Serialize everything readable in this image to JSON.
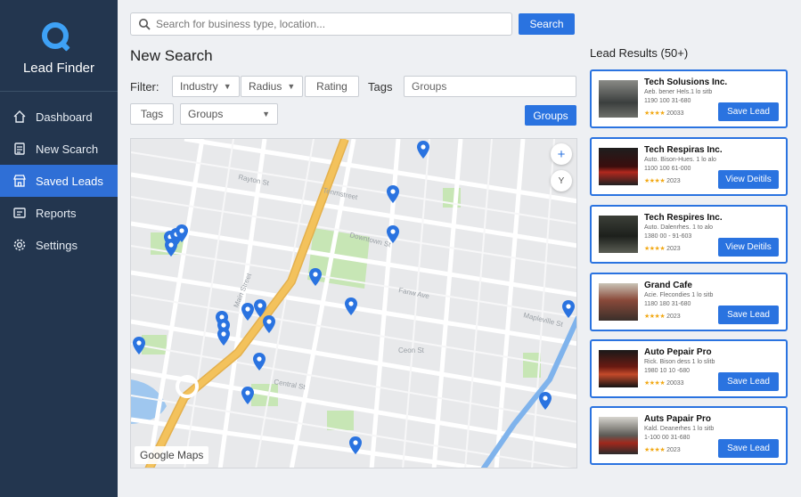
{
  "sidebar": {
    "brand": "Lead Finder",
    "items": [
      {
        "label": "Dashboard",
        "icon": "home-icon",
        "active": false
      },
      {
        "label": "New Scarch",
        "icon": "document-icon",
        "active": false
      },
      {
        "label": "Saved Leads",
        "icon": "store-icon",
        "active": true
      },
      {
        "label": "Reports",
        "icon": "report-icon",
        "active": false
      },
      {
        "label": "Settings",
        "icon": "gear-icon",
        "active": false
      }
    ]
  },
  "search": {
    "placeholder": "Search for business type, location...",
    "button": "Search"
  },
  "main": {
    "title": "New Search",
    "filter_label": "Filter:",
    "chips": {
      "industry": "Industry",
      "radius": "Radius",
      "rating": "Rating",
      "tags": "Tags",
      "groups": "Groups"
    },
    "tags_label": "Tags",
    "groups_placeholder": "Groups",
    "groups_button": "Groups"
  },
  "map": {
    "zoom_in": "+",
    "locate": "Y",
    "attribution": "Google Maps"
  },
  "results": {
    "title": "Lead Results (50+)",
    "leads": [
      {
        "name": "Tech Solusions Inc.",
        "line1": "Aeb. bener Hels.1 lo sitb",
        "line2": "1190 100 31-680",
        "rating": "20033",
        "stars": "★★★★",
        "button": "Save Lead"
      },
      {
        "name": "Tech Respiras Inc.",
        "line1": "Auto. Bison-Hues. 1 lo alo",
        "line2": "1100 100 61-000",
        "rating": "2023",
        "stars": "★★★★",
        "button": "View Deitils"
      },
      {
        "name": "Tech Respires Inc.",
        "line1": "Auto. Dalenrhes. 1 to alo",
        "line2": "1380 00 - 91-603",
        "rating": "2023",
        "stars": "★★★★",
        "button": "View Deitils"
      },
      {
        "name": "Grand Cafe",
        "line1": "Acie. Flecondies 1 lo sitb",
        "line2": "1180 180 31-680",
        "rating": "2023",
        "stars": "★★★★",
        "button": "Save Lead"
      },
      {
        "name": "Auto Pepair Pro",
        "line1": "Rick. Bison dess 1 lo slitb",
        "line2": "1980 10 10 -680",
        "rating": "20033",
        "stars": "★★★★",
        "button": "Save Lead"
      },
      {
        "name": "Auts Papair Pro",
        "line1": "Kald. Deanerhes 1 lo sitb",
        "line2": "1-100 00 31-680",
        "rating": "2023",
        "stars": "★★★★",
        "button": "Save Lead"
      }
    ]
  },
  "colors": {
    "sidebar_bg": "#23364f",
    "accent": "#2a73e0",
    "star": "#f2a916",
    "map_road_major": "#f3c25c",
    "map_water": "#9fc7ef",
    "map_park": "#c7e6b5"
  }
}
